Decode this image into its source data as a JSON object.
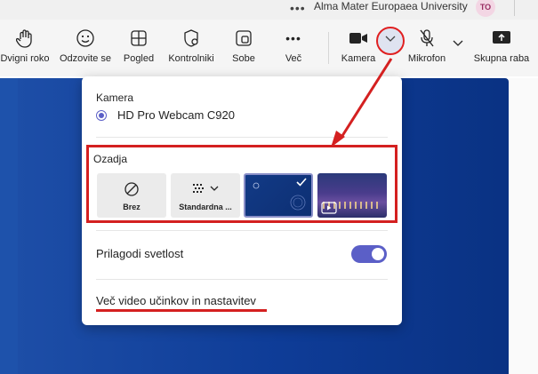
{
  "titlebar": {
    "more_icon": "ellipsis-icon",
    "organization": "Alma Mater Europaea University",
    "avatar_initials": "TO"
  },
  "toolbar": {
    "items": [
      {
        "label": "Dvigni roko",
        "icon": "raise-hand-icon"
      },
      {
        "label": "Odzovite se",
        "icon": "smiley-icon"
      },
      {
        "label": "Pogled",
        "icon": "grid-view-icon"
      },
      {
        "label": "Kontrolniki",
        "icon": "shield-settings-icon"
      },
      {
        "label": "Sobe",
        "icon": "breakout-rooms-icon"
      },
      {
        "label": "Več",
        "icon": "more-icon"
      },
      {
        "label": "Kamera",
        "icon": "camera-icon"
      },
      {
        "label": "Mikrofon",
        "icon": "mic-off-icon"
      },
      {
        "label": "Skupna raba",
        "icon": "share-icon"
      }
    ]
  },
  "panel": {
    "camera_section_label": "Kamera",
    "camera_device": "HD Pro Webcam C920",
    "backgrounds_label": "Ozadja",
    "backgrounds": [
      {
        "label": "Brez",
        "icon": "no-background-icon"
      },
      {
        "label": "Standardna ...",
        "icon": "blur-icon"
      },
      {
        "label": "",
        "selected": true
      },
      {
        "label": "",
        "icon": "video-background-icon"
      }
    ],
    "brightness_label": "Prilagodi svetlost",
    "brightness_enabled": true,
    "more_link": "Več video učinkov in nastavitev"
  },
  "colors": {
    "accent": "#5b5fc7",
    "annotation_red": "#d42020",
    "video_blue": "#0e3c97"
  }
}
